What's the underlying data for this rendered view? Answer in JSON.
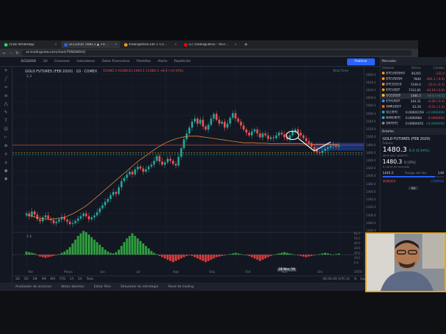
{
  "browser": {
    "tabs": [
      {
        "label": "(558) WhatsApp",
        "color": "#25d366",
        "active": false
      },
      {
        "label": "GCG2020 1480.3 ▲ +0.54% (B)",
        "color": "#2962ff",
        "active": true
      },
      {
        "label": "tradinglatino.net > Criptomonedas",
        "color": "#f7931a",
        "active": false
      },
      {
        "label": "(1) TradingLatino - YouTube",
        "color": "#ff0000",
        "active": false
      }
    ],
    "new_tab": "+",
    "address": "es.tradingview.com/chart/7RNGNOH2/"
  },
  "toolbar": {
    "symbol": "GCG2020",
    "items": [
      "1D",
      "Crossover",
      "Indicadores",
      "Datos Financieros",
      "Plantillas",
      "Alerta",
      "Repetición"
    ],
    "publish_label": "Publicar"
  },
  "chart_header": {
    "title": "GOLD FUTURES (FEB 2020) · 1D · COMEX",
    "ohlc": "O1480.3 H1480.8 L1464.5 C1480.3 +8.0 (+0.54%)",
    "sub": "1.3",
    "status": "Real Time"
  },
  "osc_label": "1.3",
  "cursor_date": "28 Nov '19",
  "bottom": {
    "ranges": [
      "1D",
      "5D",
      "1M",
      "3M",
      "6M",
      "YTD",
      "1A",
      "5A",
      "Todo"
    ],
    "time": "06:56:49 (UTC-4)",
    "opts": [
      "%",
      "log",
      "auto"
    ]
  },
  "panels": [
    "Analizador de acciones",
    "Notas abiertas",
    "Editor Pine",
    "Simulador de estrategia",
    "Panel de trading"
  ],
  "watchlist": {
    "header": "Mercados",
    "cols": [
      "Símbolo",
      "Último",
      "Cambio"
    ],
    "rows": [
      {
        "sym": "BTCUSDSHO",
        "last": "81265",
        "chg": "-131.0",
        "dir": "neg",
        "color": "#f7931a"
      },
      {
        "sym": "BTCUSDSH",
        "last": "7840",
        "chg": "-491.1 (-6.0)",
        "dir": "neg",
        "color": "#f7931a"
      },
      {
        "sym": "BTCZ2019",
        "last": "7240.0",
        "chg": "-25.0 (-0.3)",
        "dir": "neg",
        "color": "#f7931a"
      },
      {
        "sym": "BTCUSDT",
        "last": "7312.81",
        "chg": "-44.18 (-0.6)",
        "dir": "neg",
        "color": "#f7931a"
      },
      {
        "sym": "GCG2020",
        "last": "1480.3",
        "chg": "+8.0 (+0.5)",
        "dir": "pos",
        "color": "#f0c419"
      },
      {
        "sym": "ETHUSDT",
        "last": "144.31",
        "chg": "-0.56 (-0.4)",
        "dir": "neg",
        "color": "#627eea"
      },
      {
        "sym": "XMRUSDT",
        "last": "53.29",
        "chg": "-0.51 (-1.0)",
        "dir": "neg",
        "color": "#ff6600"
      },
      {
        "sym": "QLCBTC",
        "last": "0.00000159",
        "chg": "+0.0000000",
        "dir": "pos",
        "color": "#26a69a"
      },
      {
        "sym": "NANOBTC",
        "last": "0.0000984",
        "chg": "-0.0000002",
        "dir": "neg",
        "color": "#4a90e2"
      },
      {
        "sym": "DNTBTC",
        "last": "0.00000051",
        "chg": "+0.0000000",
        "dir": "pos",
        "color": "#888888"
      }
    ],
    "section": "Detalles",
    "detail_title": "GOLD FUTURES (FEB 2020)",
    "detail_exchange": "Futuros",
    "detail_price": "1480.3",
    "detail_change": "8.0 (0.54%)",
    "detail_note": "MERCADO ABIERTO",
    "detail_price2": "1480.3",
    "detail_change2": "0 (0%)",
    "detail_note2": "A cierre de mercado",
    "range_low": "1465.5",
    "range_label": "Rango del día",
    "range_high": "148",
    "sell_label": "VENDER",
    "buy_label": "COMPRA",
    "vol_label": "Vol"
  },
  "axis": {
    "price_ticks": [
      "1660.0",
      "1640.0",
      "1620.0",
      "1600.0",
      "1580.0",
      "1560.0",
      "1540.0",
      "1520.0",
      "1500.0",
      "1480.0",
      "1460.0",
      "1440.0",
      "1420.0",
      "1400.0",
      "1380.0",
      "1360.0",
      "1340.0",
      "1320.0",
      "1300.0",
      "1280.0",
      "1260.0"
    ],
    "osc_ticks": [
      "60.0",
      "50.0",
      "40.0",
      "30.0",
      "20.0",
      "10.0",
      "0.0"
    ],
    "months": [
      "Abr",
      "Mayo",
      "Jun",
      "Jul",
      "Ago",
      "Sep",
      "Oct",
      "Nov",
      "Dic",
      "2020"
    ]
  },
  "chart_data": {
    "type": "candlestick",
    "title": "GOLD FUTURES (FEB 2020) · 1D · COMEX",
    "ylim": [
      1260,
      1670
    ],
    "close": [
      1305,
      1298,
      1310,
      1302,
      1290,
      1285,
      1295,
      1300,
      1292,
      1288,
      1280,
      1284,
      1290,
      1296,
      1289,
      1284,
      1278,
      1280,
      1286,
      1292,
      1298,
      1305,
      1298,
      1290,
      1295,
      1300,
      1308,
      1318,
      1326,
      1335,
      1342,
      1352,
      1360,
      1355,
      1372,
      1388,
      1396,
      1405,
      1412,
      1405,
      1418,
      1425,
      1420,
      1412,
      1418,
      1425,
      1430,
      1440,
      1452,
      1438,
      1430,
      1436,
      1445,
      1440,
      1432,
      1428,
      1450,
      1472,
      1495,
      1510,
      1525,
      1540,
      1548,
      1535,
      1545,
      1528,
      1520,
      1532,
      1548,
      1560,
      1545,
      1535,
      1540,
      1525,
      1535,
      1550,
      1562,
      1548,
      1540,
      1530,
      1520,
      1512,
      1505,
      1515,
      1520,
      1510,
      1500,
      1510,
      1505,
      1496,
      1500,
      1498,
      1505,
      1512,
      1508,
      1500,
      1495,
      1505,
      1515,
      1520,
      1512,
      1505,
      1498,
      1490,
      1485,
      1475,
      1468,
      1462,
      1460,
      1465,
      1470,
      1474,
      1478,
      1480,
      1476,
      1480
    ],
    "ema": [
      1300,
      1299,
      1298,
      1296,
      1294,
      1293,
      1292,
      1291,
      1290,
      1290,
      1291,
      1292,
      1293,
      1294,
      1296,
      1298,
      1301,
      1304,
      1308,
      1312,
      1316,
      1320,
      1325,
      1330,
      1336,
      1342,
      1348,
      1354,
      1360,
      1366,
      1372,
      1378,
      1384,
      1390,
      1396,
      1402,
      1408,
      1414,
      1420,
      1426,
      1432,
      1438,
      1443,
      1448,
      1453,
      1458,
      1463,
      1468,
      1473,
      1477,
      1481,
      1485,
      1488,
      1491,
      1494,
      1496,
      1498,
      1500,
      1501,
      1502,
      1503,
      1503,
      1503,
      1503,
      1502,
      1501,
      1500,
      1499,
      1498,
      1497,
      1496,
      1495,
      1494,
      1493,
      1492,
      1491,
      1490,
      1489,
      1488,
      1487,
      1486,
      1486,
      1486,
      1486,
      1486,
      1485,
      1485,
      1485,
      1485,
      1484,
      1484,
      1484,
      1484,
      1484,
      1484,
      1484,
      1484,
      1484,
      1484,
      1484,
      1484,
      1484,
      1483,
      1483,
      1483,
      1483,
      1482,
      1482,
      1482,
      1482,
      1482,
      1482,
      1482,
      1482,
      1482,
      1482
    ],
    "osc": [
      5,
      4,
      3,
      2,
      -1,
      -3,
      -4,
      -5,
      -4,
      -3,
      -2,
      -1,
      1,
      3,
      5,
      8,
      12,
      18,
      24,
      30,
      34,
      38,
      36,
      32,
      28,
      24,
      20,
      16,
      12,
      8,
      5,
      3,
      2,
      4,
      8,
      14,
      20,
      26,
      30,
      34,
      30,
      26,
      22,
      18,
      14,
      10,
      6,
      3,
      1,
      -2,
      -4,
      -6,
      -8,
      -10,
      -12,
      -10,
      -8,
      -6,
      -4,
      -2,
      -1,
      -2,
      -4,
      -6,
      -8,
      -10,
      -12,
      -10,
      -8,
      -6,
      -4,
      -3,
      -2,
      -1,
      0,
      1,
      2,
      3,
      2,
      1,
      0,
      -1,
      -2,
      -4,
      -6,
      -8,
      -10,
      -8,
      -6,
      -4,
      -2,
      0,
      1,
      2,
      3,
      4,
      3,
      2,
      1,
      0,
      -1,
      -2,
      -3,
      -4,
      -3,
      -2,
      -1,
      0,
      1,
      2,
      3,
      2,
      1,
      0,
      1,
      2
    ],
    "hlines": [
      1480,
      1460,
      1455
    ]
  }
}
